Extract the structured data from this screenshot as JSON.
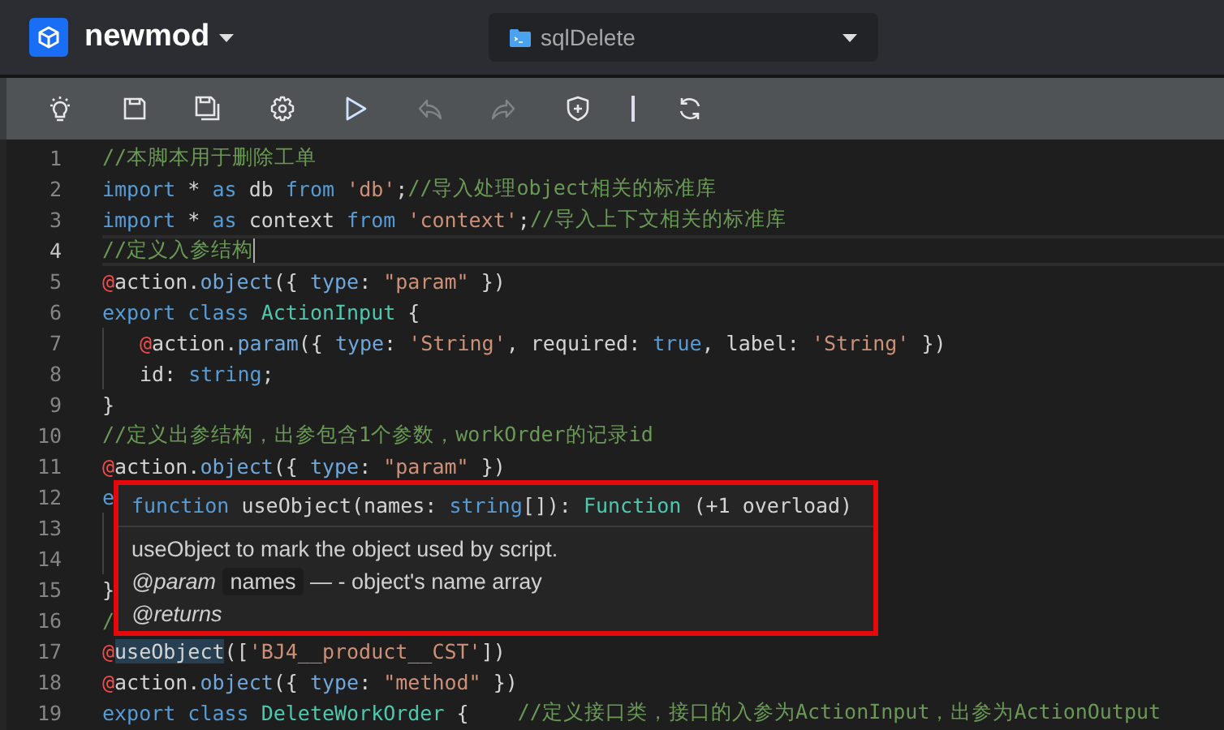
{
  "header": {
    "project": "newmod",
    "file": "sqlDelete"
  },
  "toolbar": [
    {
      "kind": "bulb",
      "disabled": false
    },
    {
      "kind": "save",
      "disabled": false
    },
    {
      "kind": "save-all",
      "disabled": false
    },
    {
      "kind": "gear",
      "disabled": false
    },
    {
      "kind": "play",
      "disabled": false
    },
    {
      "kind": "undo",
      "disabled": true
    },
    {
      "kind": "redo",
      "disabled": true
    },
    {
      "kind": "shield",
      "disabled": false
    },
    {
      "kind": "separator"
    },
    {
      "kind": "refresh",
      "disabled": false
    }
  ],
  "editor": {
    "lines": [
      {
        "number": "1",
        "current": false,
        "indent": false,
        "tokens": [
          {
            "kind": "comment",
            "text": "//本脚本用于删除工单"
          }
        ]
      },
      {
        "number": "2",
        "current": false,
        "indent": false,
        "tokens": [
          {
            "kind": "keyword",
            "text": "import"
          },
          {
            "kind": "plain",
            "text": " * "
          },
          {
            "kind": "keyword",
            "text": "as"
          },
          {
            "kind": "plain",
            "text": " db "
          },
          {
            "kind": "keyword",
            "text": "from "
          },
          {
            "kind": "string",
            "text": "'db'"
          },
          {
            "kind": "plain",
            "text": ";"
          },
          {
            "kind": "comment",
            "text": "//导入处理object相关的标准库"
          }
        ]
      },
      {
        "number": "3",
        "current": false,
        "indent": false,
        "tokens": [
          {
            "kind": "keyword",
            "text": "import"
          },
          {
            "kind": "plain",
            "text": " * "
          },
          {
            "kind": "keyword",
            "text": "as"
          },
          {
            "kind": "plain",
            "text": " context "
          },
          {
            "kind": "keyword",
            "text": "from "
          },
          {
            "kind": "string",
            "text": "'context'"
          },
          {
            "kind": "plain",
            "text": ";"
          },
          {
            "kind": "comment",
            "text": "//导入上下文相关的标准库"
          }
        ]
      },
      {
        "number": "4",
        "current": true,
        "indent": false,
        "tokens": [
          {
            "kind": "comment",
            "text": "//定义入参结构"
          }
        ]
      },
      {
        "number": "5",
        "current": false,
        "indent": false,
        "tokens": [
          {
            "kind": "decorator",
            "text": "@"
          },
          {
            "kind": "plain",
            "text": "action."
          },
          {
            "kind": "member",
            "text": "object"
          },
          {
            "kind": "plain",
            "text": "({ "
          },
          {
            "kind": "member",
            "text": "type"
          },
          {
            "kind": "plain",
            "text": ": "
          },
          {
            "kind": "string",
            "text": "\"param\""
          },
          {
            "kind": "plain",
            "text": " })"
          }
        ]
      },
      {
        "number": "6",
        "current": false,
        "indent": false,
        "tokens": [
          {
            "kind": "keyword",
            "text": "export class "
          },
          {
            "kind": "class",
            "text": "ActionInput"
          },
          {
            "kind": "plain",
            "text": " {"
          }
        ]
      },
      {
        "number": "7",
        "current": false,
        "indent": true,
        "tokens": [
          {
            "kind": "decorator",
            "text": "@"
          },
          {
            "kind": "plain",
            "text": "action."
          },
          {
            "kind": "member",
            "text": "param"
          },
          {
            "kind": "plain",
            "text": "({ "
          },
          {
            "kind": "member",
            "text": "type"
          },
          {
            "kind": "plain",
            "text": ": "
          },
          {
            "kind": "string",
            "text": "'String'"
          },
          {
            "kind": "plain",
            "text": ", required: "
          },
          {
            "kind": "keyword",
            "text": "true"
          },
          {
            "kind": "plain",
            "text": ", label: "
          },
          {
            "kind": "string",
            "text": "'String'"
          },
          {
            "kind": "plain",
            "text": " })"
          }
        ]
      },
      {
        "number": "8",
        "current": false,
        "indent": true,
        "tokens": [
          {
            "kind": "plain",
            "text": "id: "
          },
          {
            "kind": "keyword",
            "text": "string"
          },
          {
            "kind": "plain",
            "text": ";"
          }
        ]
      },
      {
        "number": "9",
        "current": false,
        "indent": false,
        "tokens": [
          {
            "kind": "plain",
            "text": "}"
          }
        ]
      },
      {
        "number": "10",
        "current": false,
        "indent": false,
        "tokens": [
          {
            "kind": "comment",
            "text": "//定义出参结构，出参包含1个参数，workOrder的记录id"
          }
        ]
      },
      {
        "number": "11",
        "current": false,
        "indent": false,
        "tokens": [
          {
            "kind": "decorator",
            "text": "@"
          },
          {
            "kind": "plain",
            "text": "action."
          },
          {
            "kind": "member",
            "text": "object"
          },
          {
            "kind": "plain",
            "text": "({ "
          },
          {
            "kind": "member",
            "text": "type"
          },
          {
            "kind": "plain",
            "text": ": "
          },
          {
            "kind": "string",
            "text": "\"param\""
          },
          {
            "kind": "plain",
            "text": " })"
          }
        ]
      },
      {
        "number": "12",
        "current": false,
        "indent": false,
        "tokens": [
          {
            "kind": "keyword",
            "text": "e"
          }
        ]
      },
      {
        "number": "13",
        "current": false,
        "indent": true
      },
      {
        "number": "14",
        "current": false,
        "indent": true
      },
      {
        "number": "15",
        "current": false,
        "indent": false,
        "tokens": [
          {
            "kind": "plain",
            "text": "}"
          }
        ]
      },
      {
        "number": "16",
        "current": false,
        "indent": false,
        "tokens": [
          {
            "kind": "comment",
            "text": "/"
          }
        ]
      },
      {
        "number": "17",
        "current": false,
        "indent": false,
        "tokens": [
          {
            "kind": "decorator",
            "text": "@"
          },
          {
            "kind": "function",
            "text": "useObject",
            "highlighted": true
          },
          {
            "kind": "plain",
            "text": "(["
          },
          {
            "kind": "string",
            "text": "'BJ4__product__CST'"
          },
          {
            "kind": "plain",
            "text": "])"
          }
        ]
      },
      {
        "number": "18",
        "current": false,
        "indent": false,
        "tokens": [
          {
            "kind": "decorator",
            "text": "@"
          },
          {
            "kind": "plain",
            "text": "action."
          },
          {
            "kind": "member",
            "text": "object"
          },
          {
            "kind": "plain",
            "text": "({ "
          },
          {
            "kind": "member",
            "text": "type"
          },
          {
            "kind": "plain",
            "text": ": "
          },
          {
            "kind": "string",
            "text": "\"method\""
          },
          {
            "kind": "plain",
            "text": " })"
          }
        ]
      },
      {
        "number": "19",
        "current": false,
        "indent": false,
        "tokens": [
          {
            "kind": "keyword",
            "text": "export class "
          },
          {
            "kind": "class",
            "text": "DeleteWorkOrder"
          },
          {
            "kind": "plain",
            "text": " {    "
          },
          {
            "kind": "comment",
            "text": "//定义接口类，接口的入参为ActionInput，出参为ActionOutput"
          }
        ]
      }
    ]
  },
  "hover_tooltip": {
    "signature": [
      {
        "kind": "keyword",
        "text": "function"
      },
      {
        "kind": "plain",
        "text": " useObject(names: "
      },
      {
        "kind": "keyword",
        "text": "string"
      },
      {
        "kind": "plain",
        "text": "[]): "
      },
      {
        "kind": "class",
        "text": "Function"
      },
      {
        "kind": "plain",
        "text": " (+1 overload)"
      }
    ],
    "description": "useObject to mark the object used by script.",
    "param": {
      "tag": "@param",
      "name": "names",
      "text": "— - object's name array"
    },
    "returns": "@returns"
  }
}
